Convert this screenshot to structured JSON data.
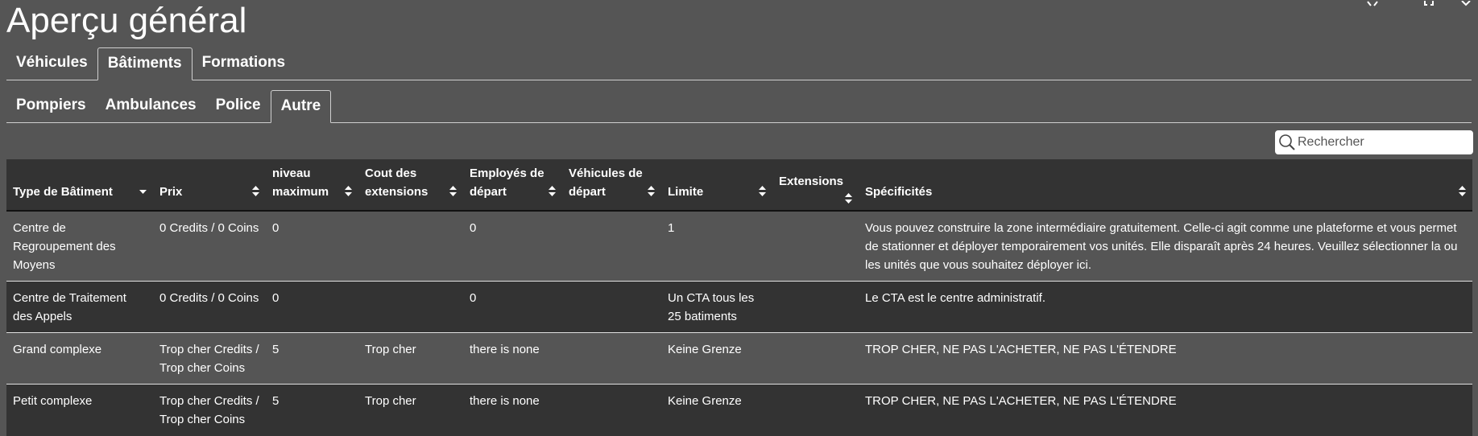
{
  "page": {
    "title": "Aperçu général"
  },
  "window_controls": [
    "minimize",
    "maximize",
    "close"
  ],
  "main_tabs": [
    {
      "label": "Véhicules",
      "active": false
    },
    {
      "label": "Bâtiments",
      "active": true
    },
    {
      "label": "Formations",
      "active": false
    }
  ],
  "sub_tabs": [
    {
      "label": "Pompiers",
      "active": false
    },
    {
      "label": "Ambulances",
      "active": false
    },
    {
      "label": "Police",
      "active": false
    },
    {
      "label": "Autre",
      "active": true
    }
  ],
  "search": {
    "placeholder": "Rechercher",
    "value": ""
  },
  "table": {
    "columns": [
      {
        "line1": "",
        "line2": "Type de Bâtiment",
        "sort": "desc"
      },
      {
        "line1": "",
        "line2": "Prix",
        "sort": "both"
      },
      {
        "line1": "niveau",
        "line2": "maximum",
        "sort": "both"
      },
      {
        "line1": "Cout des",
        "line2": "extensions",
        "sort": "both"
      },
      {
        "line1": "Employés de",
        "line2": "départ",
        "sort": "both"
      },
      {
        "line1": "Véhicules de",
        "line2": "départ",
        "sort": "both"
      },
      {
        "line1": "",
        "line2": "Limite",
        "sort": "both"
      },
      {
        "line1": "Extensions",
        "line2": "",
        "sort": "both"
      },
      {
        "line1": "",
        "line2": "Spécificités",
        "sort": "both"
      }
    ],
    "rows": [
      {
        "type": "Centre de Regroupement des Moyens",
        "prix": "0 Credits / 0 Coins",
        "niveau": "0",
        "cout": "",
        "employes": "0",
        "vehicules": "",
        "limite": "1",
        "extensions": "",
        "specificites": "Vous pouvez construire la zone intermédiaire gratuitement. Celle-ci agit comme une plateforme et vous permet de stationner et déployer temporairement vos unités. Elle disparaît après 24 heures. Veuillez sélectionner la ou les unités que vous souhaitez déployer ici."
      },
      {
        "type": "Centre de Traitement des Appels",
        "prix": "0 Credits / 0 Coins",
        "niveau": "0",
        "cout": "",
        "employes": "0",
        "vehicules": "",
        "limite": "Un CTA tous les 25 batiments",
        "extensions": "",
        "specificites": "Le CTA est le centre administratif."
      },
      {
        "type": "Grand complexe",
        "prix": "Trop cher Credits / Trop cher Coins",
        "niveau": "5",
        "cout": "Trop cher",
        "employes": "there is none",
        "vehicules": "",
        "limite": "Keine Grenze",
        "extensions": "",
        "specificites": "TROP CHER, NE PAS L'ACHETER, NE PAS L'ÉTENDRE"
      },
      {
        "type": "Petit complexe",
        "prix": "Trop cher Credits / Trop cher Coins",
        "niveau": "5",
        "cout": "Trop cher",
        "employes": "there is none",
        "vehicules": "",
        "limite": "Keine Grenze",
        "extensions": "",
        "specificites": "TROP CHER, NE PAS L'ACHETER, NE PAS L'ÉTENDRE"
      }
    ]
  },
  "colors": {
    "background": "#555555",
    "header": "#333333",
    "row_alt": "#333333",
    "text": "#ffffff"
  }
}
